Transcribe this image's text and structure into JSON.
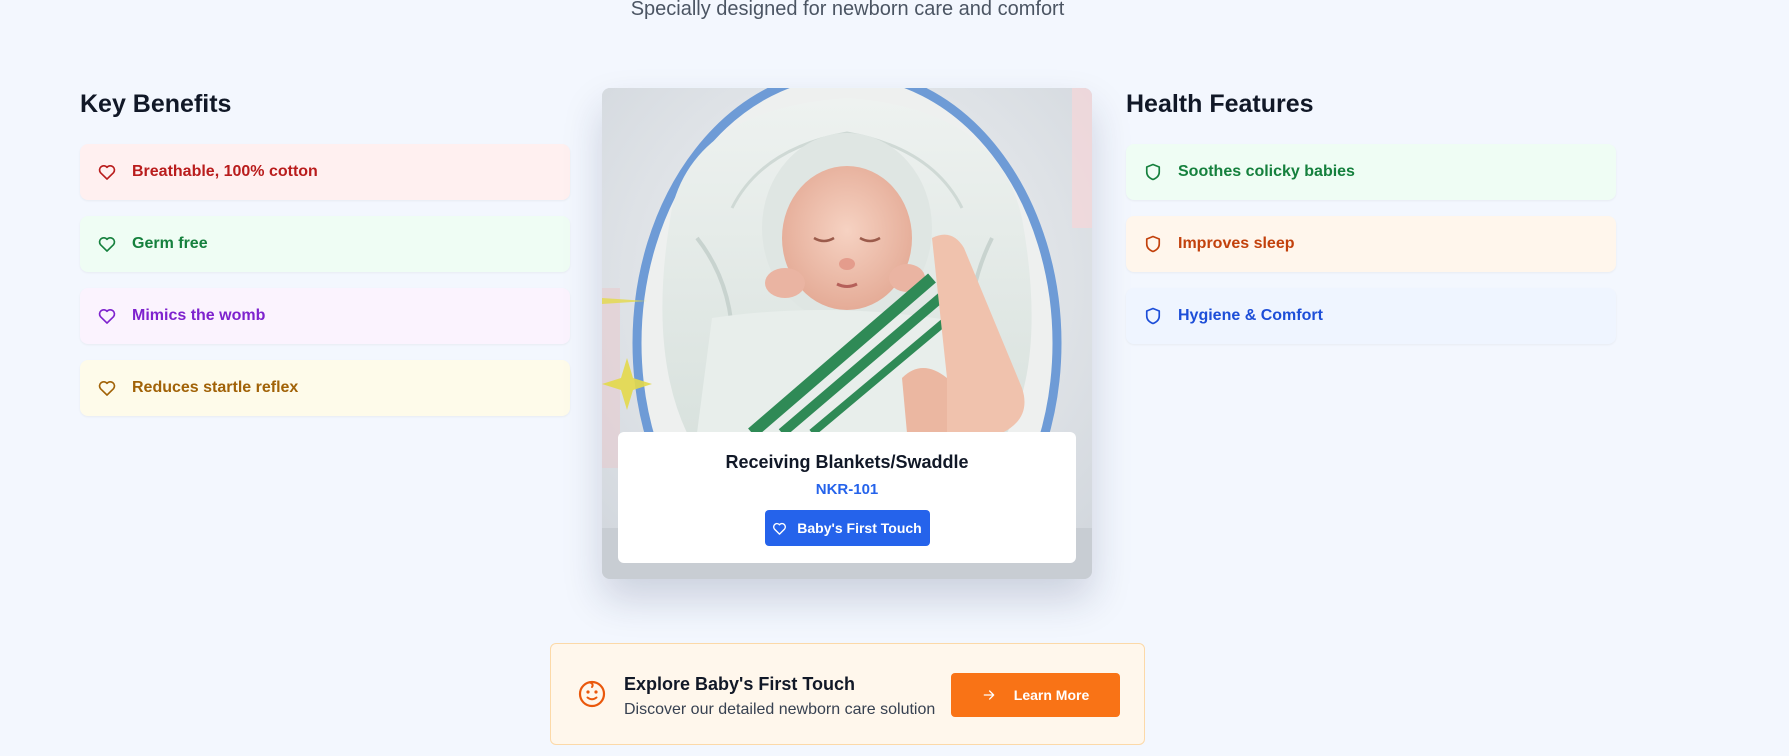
{
  "header": {
    "subtitle": "Specially designed for newborn care and comfort"
  },
  "benefits": {
    "title": "Key Benefits",
    "icon": "heart-icon",
    "items": [
      {
        "label": "Breathable, 100% cotton",
        "color": "#b91c1c",
        "bg": "#fff0f0"
      },
      {
        "label": "Germ free",
        "color": "#15803d",
        "bg": "#effdf4"
      },
      {
        "label": "Mimics the womb",
        "color": "#7e22ce",
        "bg": "#fbf3fe"
      },
      {
        "label": "Reduces startle reflex",
        "color": "#a16207",
        "bg": "#fefbea"
      }
    ]
  },
  "health": {
    "title": "Health Features",
    "icon": "shield-icon",
    "items": [
      {
        "label": "Soothes colicky babies",
        "color": "#15803d",
        "bg": "#effdf4"
      },
      {
        "label": "Improves sleep",
        "color": "#c2410c",
        "bg": "#fff6ec"
      },
      {
        "label": "Hygiene & Comfort",
        "color": "#1d4ed8",
        "bg": "#eff5ff"
      }
    ]
  },
  "product": {
    "name": "Receiving Blankets/Swaddle",
    "code": "NKR-101",
    "button_label": "Baby's First Touch",
    "button_icon": "heart-icon",
    "image": "swaddled-newborn-illustration"
  },
  "cta": {
    "icon": "baby-face-icon",
    "title": "Explore Baby's First Touch",
    "subtitle": "Discover our detailed newborn care solution",
    "button_label": "Learn More",
    "button_icon": "arrow-right-icon"
  },
  "colors": {
    "accent_blue": "#2563eb",
    "accent_orange": "#f97316",
    "page_bg": "#f3f7fe"
  }
}
